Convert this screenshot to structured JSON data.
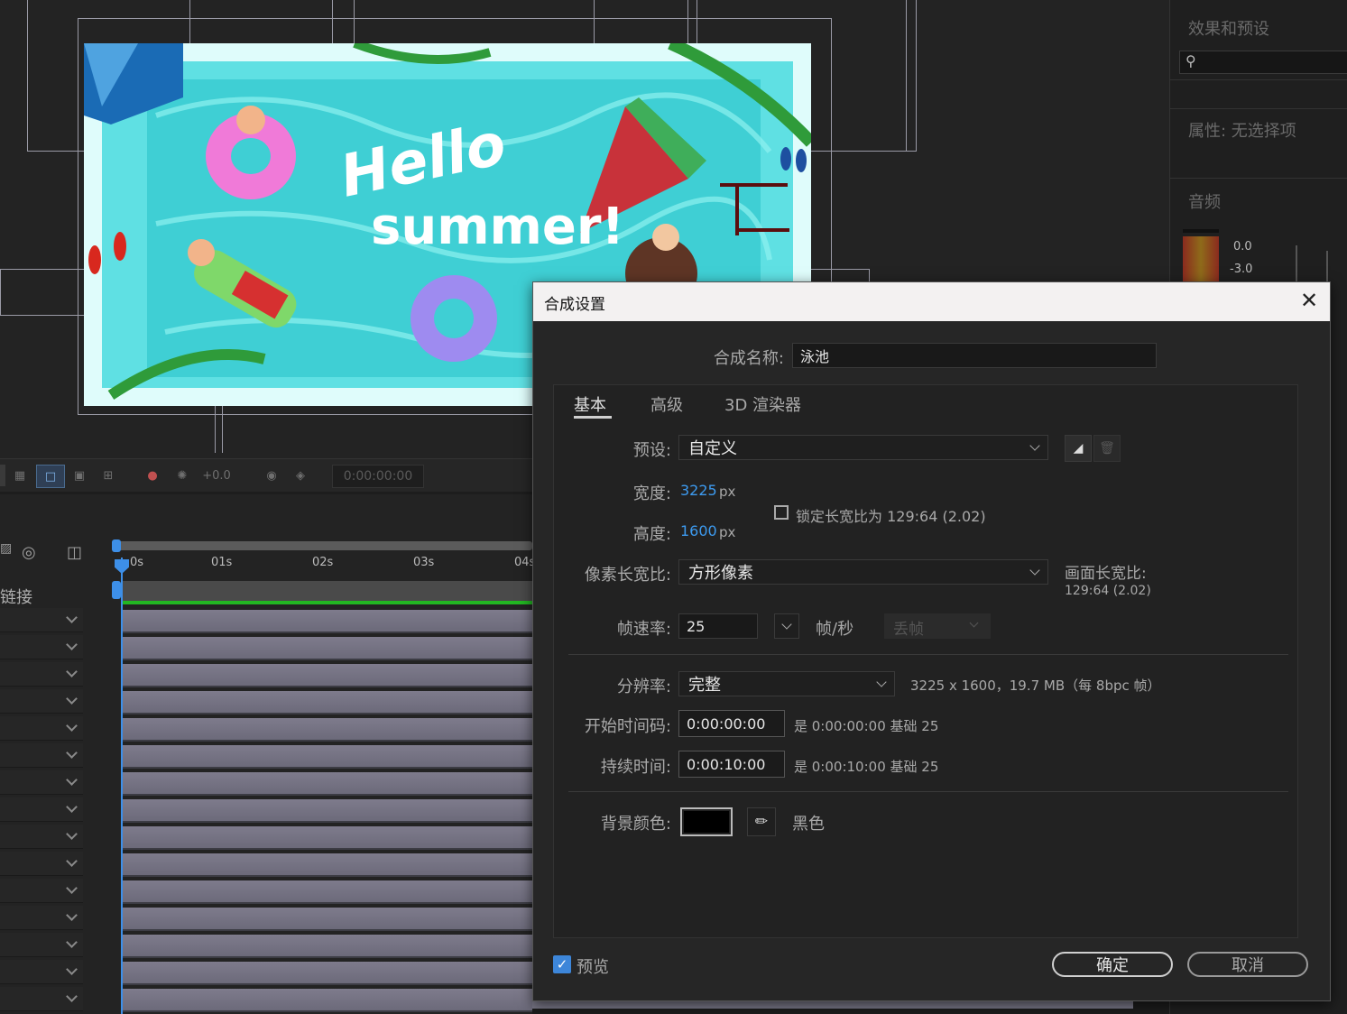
{
  "right_panel": {
    "effects_title": "效果和预设",
    "properties_title": "属性: 无选择项",
    "audio_title": "音频",
    "audio_levels": [
      "0.0",
      "-3.0"
    ]
  },
  "artwork": {
    "line1": "Hello",
    "line2": "summer!"
  },
  "viewer_toolbar": {
    "exposure": "+0.0",
    "timecode": "0:00:00:00"
  },
  "timeline": {
    "ruler": [
      "0s",
      "01s",
      "02s",
      "03s",
      "04s"
    ],
    "column_label": "链接"
  },
  "dialog": {
    "title": "合成设置",
    "name_label": "合成名称:",
    "name_value": "泳池",
    "tabs": [
      "基本",
      "高级",
      "3D 渲染器"
    ],
    "preset_label": "预设:",
    "preset_value": "自定义",
    "width_label": "宽度:",
    "width_value": "3225",
    "height_label": "高度:",
    "height_value": "1600",
    "unit_px": "px",
    "lock_label": "锁定长宽比为 129:64 (2.02)",
    "pixel_aspect_label": "像素长宽比:",
    "pixel_aspect_value": "方形像素",
    "frame_aspect_label": "画面长宽比:",
    "frame_aspect_value": "129:64 (2.02)",
    "fps_label": "帧速率:",
    "fps_value": "25",
    "fps_unit": "帧/秒",
    "drop_frame": "丢帧",
    "resolution_label": "分辨率:",
    "resolution_value": "完整",
    "resolution_info": "3225 x 1600，19.7 MB（每 8bpc 帧）",
    "start_label": "开始时间码:",
    "start_value": "0:00:00:00",
    "start_info": "是 0:00:00:00  基础 25",
    "duration_label": "持续时间:",
    "duration_value": "0:00:10:00",
    "duration_info": "是 0:00:10:00  基础 25",
    "bg_label": "背景颜色:",
    "bg_color": "#000000",
    "bg_name": "黑色",
    "preview_label": "预览",
    "ok": "确定",
    "cancel": "取消"
  }
}
